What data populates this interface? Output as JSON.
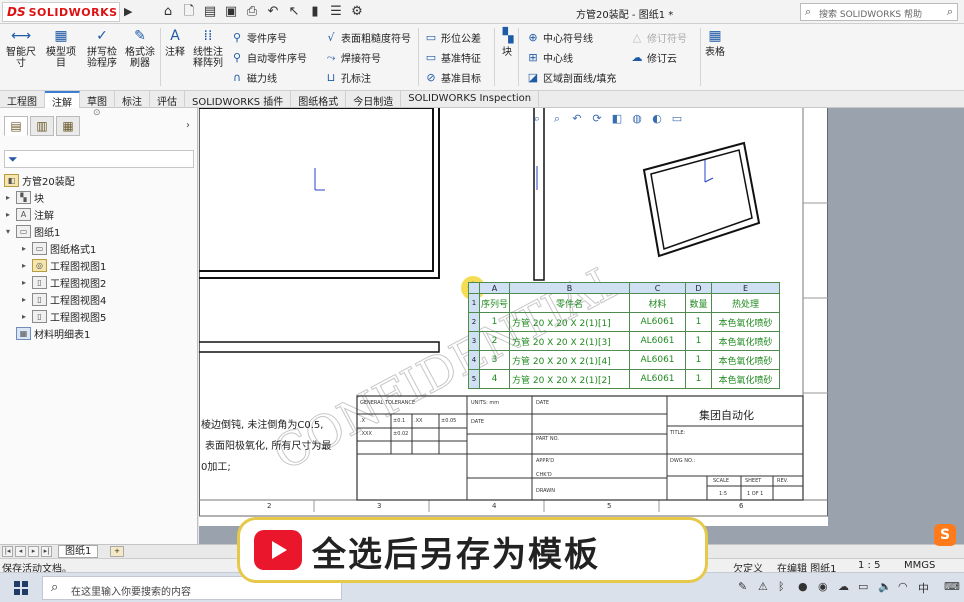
{
  "app": {
    "logo_ds": "DS",
    "logo_name": "SOLIDWORKS",
    "title": "方管20装配 - 图纸1 *",
    "search_placeholder": "搜索 SOLIDWORKS 帮助"
  },
  "ribbon": {
    "big": [
      {
        "label": "智能尺\n寸",
        "icon": "smart-dimension-icon"
      },
      {
        "label": "模型项\n目",
        "icon": "model-items-icon"
      },
      {
        "label": "拼写检\n验程序",
        "icon": "spell-check-icon"
      },
      {
        "label": "格式涂\n刷器",
        "icon": "format-painter-icon"
      },
      {
        "label": "注释",
        "icon": "note-icon"
      },
      {
        "label": "线性注\n释阵列",
        "icon": "linear-pattern-icon"
      },
      {
        "label": "块",
        "icon": "block-icon"
      },
      {
        "label": "表格",
        "icon": "table-icon"
      }
    ],
    "col1": [
      "零件序号",
      "自动零件序号",
      "磁力线"
    ],
    "col2": [
      "表面粗糙度符号",
      "焊接符号",
      "孔标注"
    ],
    "col3": [
      "形位公差",
      "基准特征",
      "基准目标"
    ],
    "col4": [
      "中心符号线",
      "中心线",
      "区域剖面线/填充"
    ],
    "col5": [
      "修订符号",
      "修订云"
    ]
  },
  "tabs": [
    "工程图",
    "注解",
    "草图",
    "标注",
    "评估",
    "SOLIDWORKS 插件",
    "图纸格式",
    "今日制造",
    "SOLIDWORKS Inspection"
  ],
  "tree": {
    "root": "方管20装配",
    "items": [
      "块",
      "注解",
      "图纸1",
      "图纸格式1",
      "工程图视图1",
      "工程图视图2",
      "工程图视图4",
      "工程图视图5",
      "材料明细表1"
    ]
  },
  "bom": {
    "col_letters": [
      "A",
      "B",
      "C",
      "D",
      "E"
    ],
    "headers": [
      "序列号",
      "零件名",
      "材料",
      "数量",
      "热处理"
    ],
    "rows": [
      [
        "1",
        "方管 20 X 20 X 2(1)[1]",
        "AL6061",
        "1",
        "本色氧化喷砂"
      ],
      [
        "2",
        "方管 20 X 20 X 2(1)[3]",
        "AL6061",
        "1",
        "本色氧化喷砂"
      ],
      [
        "3",
        "方管 20 X 20 X 2(1)[4]",
        "AL6061",
        "1",
        "本色氧化喷砂"
      ],
      [
        "4",
        "方管 20 X 20 X 2(1)[2]",
        "AL6061",
        "1",
        "本色氧化喷砂"
      ]
    ],
    "row_numbers": [
      "1",
      "2",
      "3",
      "4",
      "5"
    ]
  },
  "notes": [
    "棱边倒钝, 未注倒角为C0.5,",
    "表面阳极氧化, 所有尺寸为最",
    "0加工;"
  ],
  "titleblock": {
    "general": "GENERAL TOLERANCE",
    "units": "UNITS: mm",
    "date": "DATE",
    "part_no": "PART NO.",
    "appr": "APPR'D",
    "chk": "CHK'D",
    "drawn": "DRAWN",
    "scale_lbl": "SCALE",
    "scale_val": "1:5",
    "sheet_lbl": "SHEET",
    "sheet_val": "1 OF 1",
    "rev_lbl": "REV.",
    "company": "集团自动化",
    "title_lbl": "TITLE:",
    "dwg_lbl": "DWG NO.:",
    "tol": [
      ".X",
      "±0.1",
      ".XX",
      "±0.05",
      ".XXX",
      "±0.02"
    ],
    "zones": [
      "2",
      "3",
      "4",
      "5",
      "6"
    ]
  },
  "watermark": "CONFIDENTIAL",
  "sheetbar": {
    "tab": "图纸1"
  },
  "status": {
    "left": "保存活动文档。",
    "under_defined": "欠定义",
    "editing": "在编辑 图纸1",
    "scale": "1 : 5",
    "units": "MMGS"
  },
  "taskbar": {
    "search": "在这里输入你要搜索的内容",
    "ime": "中"
  },
  "overlay": {
    "subtitle": "全选后另存为模板"
  }
}
